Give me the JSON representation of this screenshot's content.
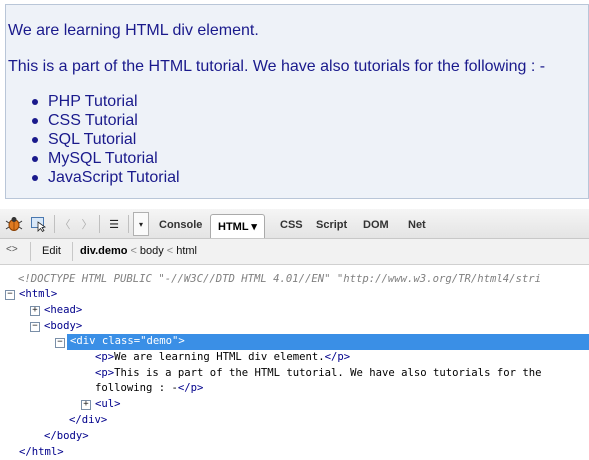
{
  "preview": {
    "paragraph1": "We are learning HTML div element.",
    "paragraph2": "This is a part of the HTML tutorial. We have also tutorials for the following : -",
    "list_items": [
      "PHP Tutorial",
      "CSS Tutorial",
      "SQL Tutorial",
      "MySQL Tutorial",
      "JavaScript Tutorial"
    ]
  },
  "toolbar": {
    "tabs": [
      "Console",
      "HTML ▾",
      "CSS",
      "Script",
      "DOM",
      "Net"
    ],
    "back_glyph": "〈",
    "forward_glyph": "〉",
    "menu_glyph": "☰",
    "dropdown_glyph": "▾"
  },
  "breadcrumb": {
    "toggle": "<>",
    "edit_label": "Edit",
    "items": [
      "div.demo",
      "body",
      "html"
    ],
    "separator": "<"
  },
  "tree": {
    "doctype": "<!DOCTYPE HTML PUBLIC \"-//W3C//DTD HTML 4.01//EN\" \"http://www.w3.org/TR/html4/stri",
    "html_open": "<html>",
    "head": "<head>",
    "body_open": "<body>",
    "div_open": "<div class=\"demo\">",
    "p1_open": "<p>",
    "p1_text": "We are learning HTML div element.",
    "p1_close": "</p>",
    "p2_open": "<p>",
    "p2_text": "This is a part of the HTML tutorial. We have also tutorials for the",
    "p2_text_cont": "following : -",
    "p2_close": "</p>",
    "ul": "<ul>",
    "div_close": "</div>",
    "body_close": "</body>",
    "html_close": "</html>",
    "expand_glyph": "+",
    "collapse_glyph": "−"
  },
  "colors": {
    "selection": "#3a8fe6",
    "tag": "#00008b",
    "preview_text": "#1a1a8c",
    "preview_bg": "#eef2f8"
  }
}
